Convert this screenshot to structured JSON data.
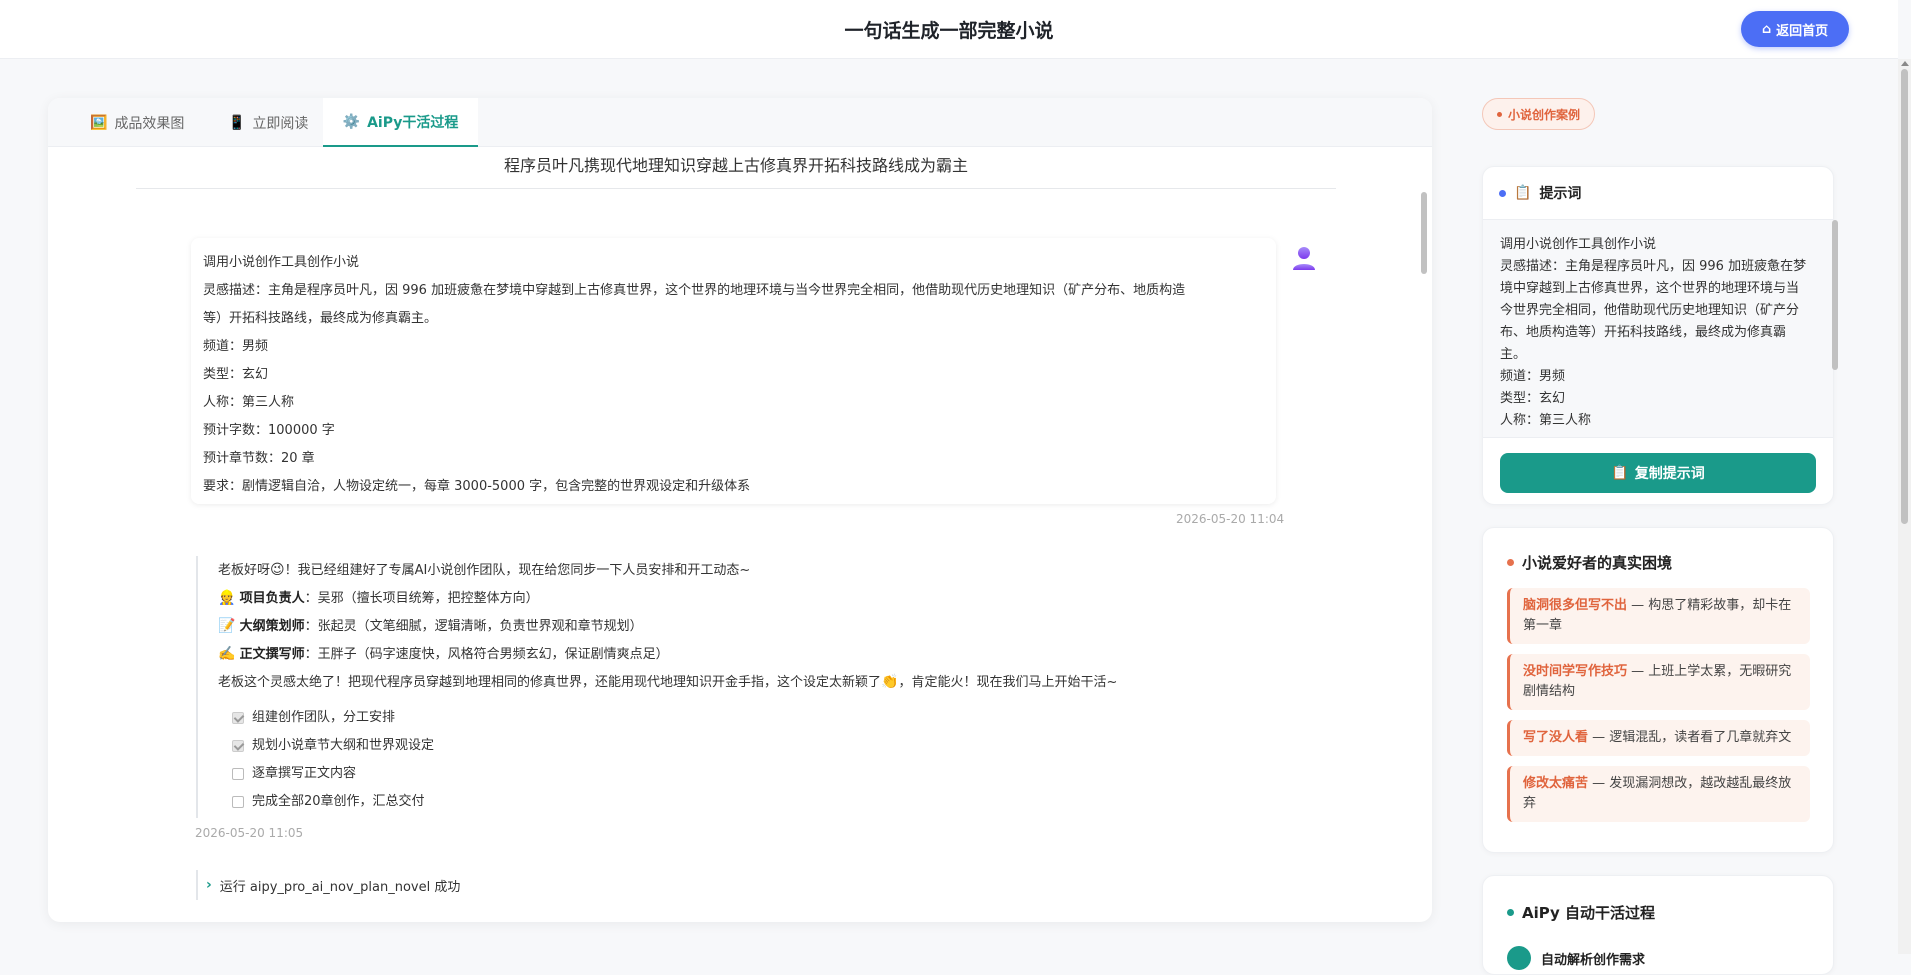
{
  "header": {
    "title": "一句话生成一部完整小说",
    "home_label": "返回首页"
  },
  "tabs": [
    {
      "label": "成品效果图"
    },
    {
      "label": "立即阅读"
    },
    {
      "label": "AiPy干活过程"
    }
  ],
  "doc_title": "程序员叶凡携现代地理知识穿越上古修真界开拓科技路线成为霸主",
  "user_message": {
    "lines": [
      "调用小说创作工具创作小说",
      "灵感描述：主角是程序员叶凡，因 996 加班疲惫在梦境中穿越到上古修真世界，这个世界的地理环境与当今世界完全相同，他借助现代历史地理知识（矿产分布、地质构造",
      "等）开拓科技路线，最终成为修真霸主。",
      "频道：男频",
      "类型：玄幻",
      "人称：第三人称",
      "预计字数：100000 字",
      "预计章节数：20 章",
      "要求：剧情逻辑自洽，人物设定统一，每章 3000-5000 字，包含完整的世界观设定和升级体系"
    ],
    "time": "2026-05-20 11:04"
  },
  "reply": {
    "intro_a": "老板好呀",
    "intro_b": "！我已经组建好了专属AI小说创作团队，现在给您同步一下人员安排和开工动态~",
    "roles": [
      {
        "emoji": "👷",
        "title": "项目负责人",
        "desc": "：吴邪（擅长项目统筹，把控整体方向）"
      },
      {
        "emoji": "📝",
        "title": "大纲策划师",
        "desc": "：张起灵（文笔细腻，逻辑清晰，负责世界观和章节规划）"
      },
      {
        "emoji": "✍️",
        "title": "正文撰写师",
        "desc": "：王胖子（码字速度快，风格符合男频玄幻，保证剧情爽点足）"
      }
    ],
    "outro_a": "老板这个灵感太绝了！把现代程序员穿越到地理相同的修真世界，还能用现代地理知识开金手指，这个设定太新颖了",
    "outro_b": "，肯定能火！现在我们马上开始干活~",
    "tasks": [
      {
        "label": "组建创作团队，分工安排",
        "done": true
      },
      {
        "label": "规划小说章节大纲和世界观设定",
        "done": true
      },
      {
        "label": "逐章撰写正文内容",
        "done": false
      },
      {
        "label": "完成全部20章创作，汇总交付",
        "done": false
      }
    ],
    "time": "2026-05-20 11:05"
  },
  "run_line": "运行 aipy_pro_ai_nov_plan_novel 成功",
  "case_badge": "小说创作案例",
  "prompt_panel": {
    "title": "提示词",
    "lines": [
      "调用小说创作工具创作小说",
      "灵感描述：主角是程序员叶凡，因 996 加班疲惫在梦",
      "境中穿越到上古修真世界，这个世界的地理环境与当",
      "今世界完全相同，他借助现代历史地理知识（矿产分",
      "布、地质构造等）开拓科技路线，最终成为修真霸",
      "主。",
      "频道：男频",
      "类型：玄幻",
      "人称：第三人称"
    ],
    "copy_label": "复制提示词"
  },
  "pain_panel": {
    "title": "小说爱好者的真实困境",
    "items": [
      {
        "key": "脑洞很多但写不出",
        "text": " — 构思了精彩故事，却卡在第一章"
      },
      {
        "key": "没时间学写作技巧",
        "text": " — 上班上学太累，无暇研究剧情结构"
      },
      {
        "key": "写了没人看",
        "text": " — 逻辑混乱，读者看了几章就弃文"
      },
      {
        "key": "修改太痛苦",
        "text": " — 发现漏洞想改，越改越乱最终放弃"
      }
    ]
  },
  "auto_panel": {
    "title": "AiPy 自动干活过程",
    "first_step": "自动解析创作需求"
  },
  "colors": {
    "accent": "#1a9a8a",
    "primary": "#4c6ef5",
    "warn": "#e0643d"
  }
}
